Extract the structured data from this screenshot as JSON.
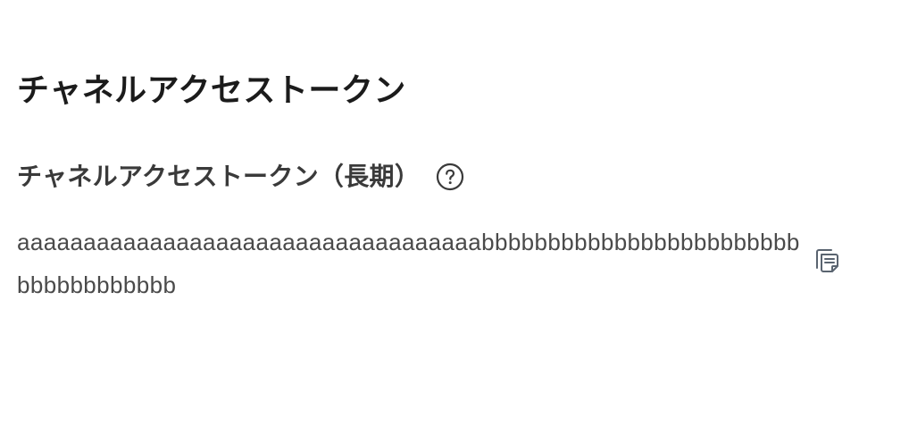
{
  "section": {
    "title": "チャネルアクセストークン"
  },
  "field": {
    "label": "チャネルアクセストークン（長期）",
    "value": "aaaaaaaaaaaaaaaaaaaaaaaaaaaaaaaaaaabbbbbbbbbbbbbbbbbbbbbbbbbbbbbbbbbbbb"
  },
  "icons": {
    "help": "help-circle-icon",
    "copy": "copy-icon"
  },
  "colors": {
    "title": "#1b1b1b",
    "label": "#3a3a3a",
    "value": "#4a4a4a",
    "icon": "#5a6470"
  }
}
